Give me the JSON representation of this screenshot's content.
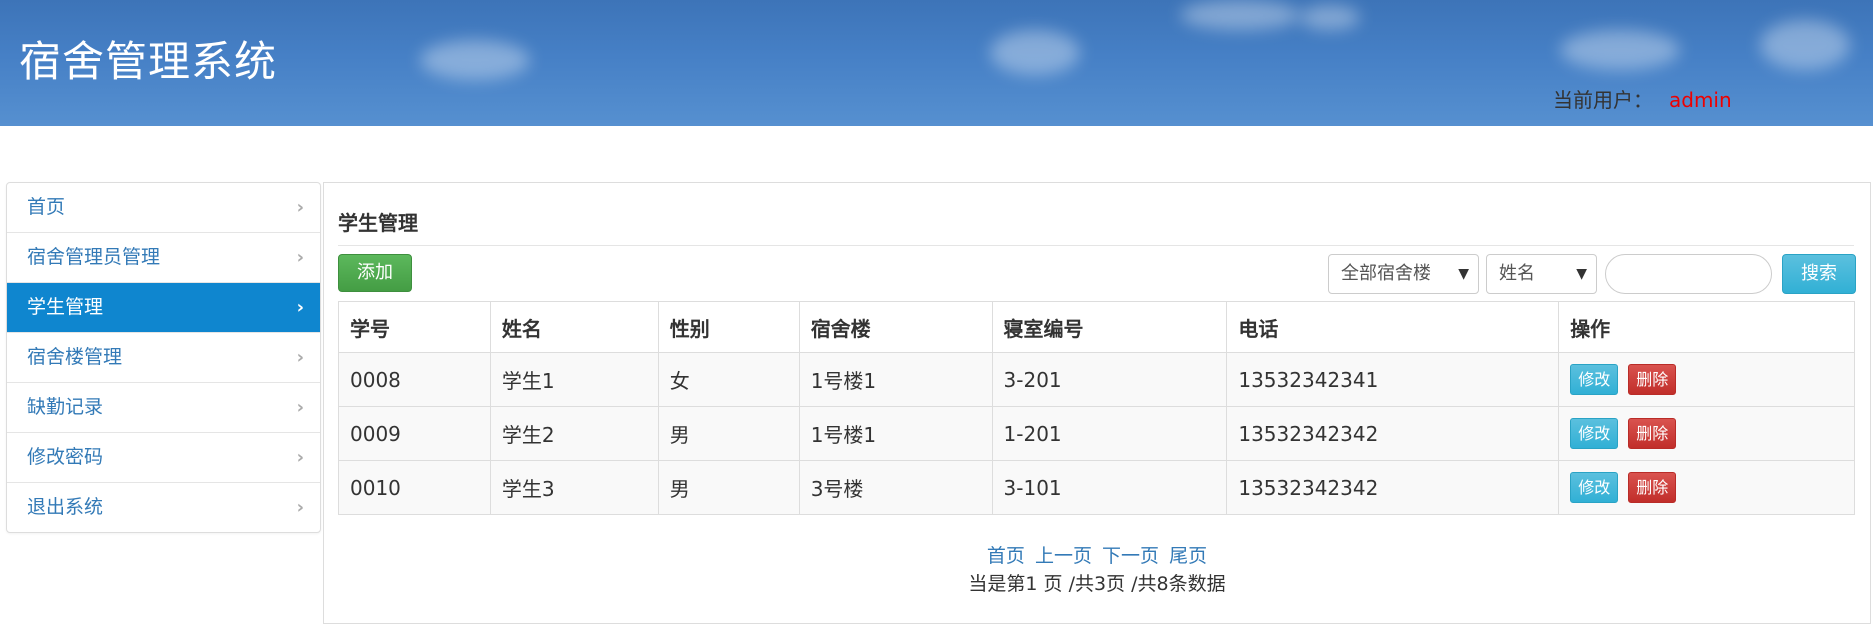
{
  "header": {
    "title": "宿舍管理系统",
    "current_user_label": "当前用户：",
    "current_user": "admin"
  },
  "sidebar": {
    "items": [
      {
        "label": "首页"
      },
      {
        "label": "宿舍管理员管理"
      },
      {
        "label": "学生管理",
        "active": true
      },
      {
        "label": "宿舍楼管理"
      },
      {
        "label": "缺勤记录"
      },
      {
        "label": "修改密码"
      },
      {
        "label": "退出系统"
      }
    ]
  },
  "main": {
    "title": "学生管理",
    "add_label": "添加",
    "building_filter": "全部宿舍楼",
    "field_filter": "姓名",
    "search_value": "",
    "search_label": "搜索",
    "columns": [
      "学号",
      "姓名",
      "性别",
      "宿舍楼",
      "寝室编号",
      "电话",
      "操作"
    ],
    "rows": [
      [
        "0008",
        "学生1",
        "女",
        "1号楼1",
        "3-201",
        "13532342341"
      ],
      [
        "0009",
        "学生2",
        "男",
        "1号楼1",
        "1-201",
        "13532342342"
      ],
      [
        "0010",
        "学生3",
        "男",
        "3号楼",
        "3-101",
        "13532342342"
      ]
    ],
    "edit_label": "修改",
    "delete_label": "删除"
  },
  "pager": {
    "first": "首页",
    "prev": "上一页",
    "next": "下一页",
    "last": "尾页",
    "info": "当是第1 页 /共3页  /共8条数据"
  },
  "colors": {
    "header_bg": "#4680c6",
    "active_nav": "#0f86cf",
    "link": "#337ab7",
    "user_name": "#ee0000"
  }
}
